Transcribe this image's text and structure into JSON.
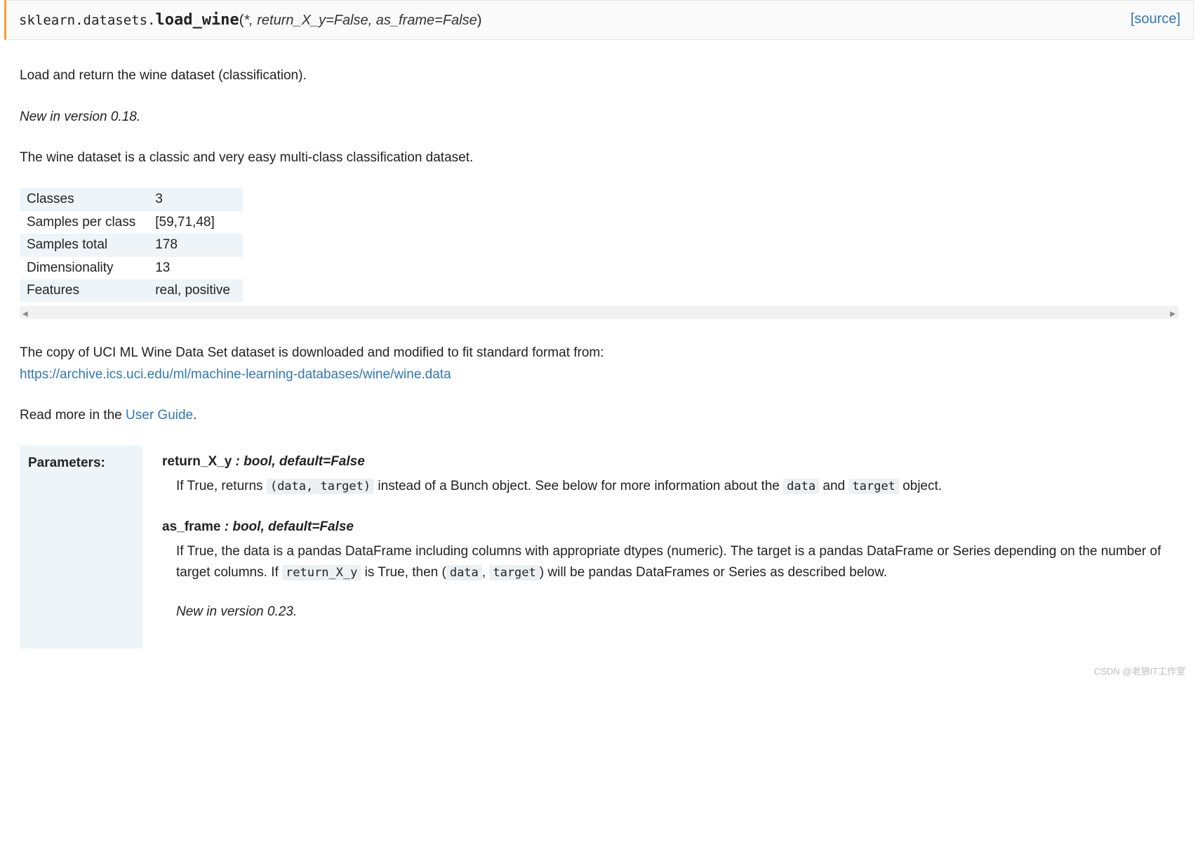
{
  "signature": {
    "module": "sklearn.datasets.",
    "func": "load_wine",
    "args_open": "(",
    "args": "*, return_X_y=False, as_frame=False",
    "args_close": ")",
    "source_label": "[source]"
  },
  "intro": "Load and return the wine dataset (classification).",
  "version_line": "New in version 0.18.",
  "intro2": "The wine dataset is a classic and very easy multi-class classification dataset.",
  "table": {
    "rows": [
      {
        "k": "Classes",
        "v": "3"
      },
      {
        "k": "Samples per class",
        "v": "[59,71,48]"
      },
      {
        "k": "Samples total",
        "v": "178"
      },
      {
        "k": "Dimensionality",
        "v": "13"
      },
      {
        "k": "Features",
        "v": "real, positive"
      }
    ]
  },
  "source_para": {
    "text": "The copy of UCI ML Wine Data Set dataset is downloaded and modified to fit standard format from: ",
    "link": "https://archive.ics.uci.edu/ml/machine-learning-databases/wine/wine.data"
  },
  "read_more": {
    "pre": "Read more in the ",
    "link_text": "User Guide",
    "post": "."
  },
  "parameters_label": "Parameters:",
  "params": {
    "return_x_y": {
      "name": "return_X_y",
      "sep": " : ",
      "type": "bool, default=False",
      "desc_pre": "If True, returns ",
      "code1": "(data, target)",
      "desc_mid": " instead of a Bunch object. See below for more information about the ",
      "code2": "data",
      "desc_mid2": " and ",
      "code3": "target",
      "desc_post": " object."
    },
    "as_frame": {
      "name": "as_frame",
      "sep": " : ",
      "type": "bool, default=False",
      "desc_pre": "If True, the data is a pandas DataFrame including columns with appropriate dtypes (numeric). The target is a pandas DataFrame or Series depending on the number of target columns. If ",
      "code1": "return_X_y",
      "desc_mid": " is True, then (",
      "code2": "data",
      "desc_mid2": ", ",
      "code3": "target",
      "desc_post": ") will be pandas DataFrames or Series as described below.",
      "version": "New in version 0.23."
    }
  },
  "watermark": "CSDN @老狼IT工作室"
}
